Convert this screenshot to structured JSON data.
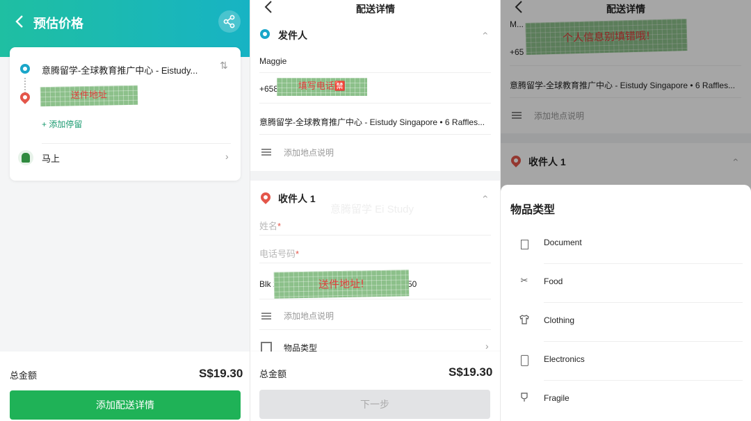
{
  "estimate_screen": {
    "title": "预估价格",
    "from_address": "意腾留学-全球教育推广中心 - Eistudy...",
    "tape_note": "送件地址",
    "add_stop": "+ 添加停留",
    "timing": "马上",
    "total_label": "总金额",
    "total_amount": "S$19.30",
    "cta_label": "添加配送详情"
  },
  "details_screen": {
    "title": "配送详情",
    "sender_heading": "发件人",
    "sender_name": "Maggie",
    "sender_phone_prefix": "+658",
    "tape_phone_note": "填写电话🈲",
    "sender_address": "意腾留学-全球教育推广中心 - Eistudy Singapore • 6 Raffles...",
    "add_note_label": "添加地点说明",
    "watermark": "意腾留学 Ei Study",
    "recipient_heading": "收件人 1",
    "name_placeholder": "姓名",
    "phone_placeholder": "电话号码",
    "required_mark": "*",
    "recipient_address_start": "Blk 2",
    "recipient_address_end": "50",
    "tape_address_note": "送件地址!",
    "item_type_label": "物品类型",
    "total_label": "总金额",
    "total_amount": "S$19.30",
    "next_label": "下一步"
  },
  "item_type_screen": {
    "title": "配送详情",
    "tape_note": "个人信息别填错哦!",
    "bg_name_fragment": "M...",
    "bg_phone_fragment": "+65",
    "bg_address": "意腾留学-全球教育推广中心 - Eistudy Singapore • 6 Raffles...",
    "bg_add_note": "添加地点说明",
    "bg_recipient_heading": "收件人 1",
    "sheet_title": "物品类型",
    "options": [
      {
        "label": "Document",
        "icon": "document-icon"
      },
      {
        "label": "Food",
        "icon": "food-icon"
      },
      {
        "label": "Clothing",
        "icon": "shirt-icon"
      },
      {
        "label": "Electronics",
        "icon": "phone-icon"
      },
      {
        "label": "Fragile",
        "icon": "fragile-icon"
      }
    ]
  },
  "colors": {
    "brand_green": "#1fb257",
    "header_teal": "#17b3c4",
    "pin_red": "#e4564a",
    "tape_green": "#8cc08a",
    "tape_text_red": "#e23c3c"
  }
}
